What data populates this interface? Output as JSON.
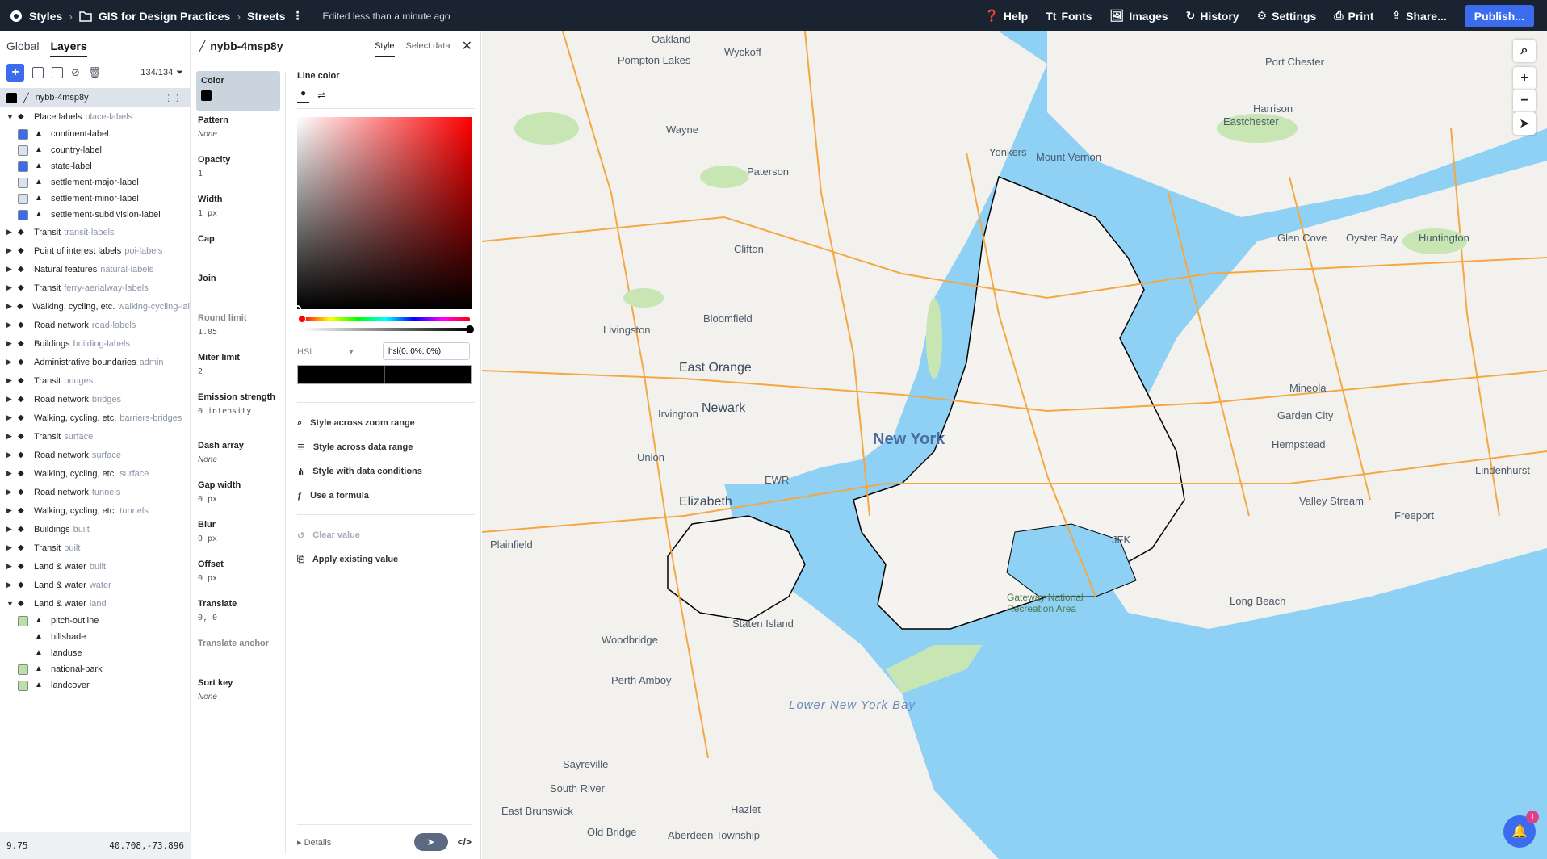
{
  "topbar": {
    "styles_label": "Styles",
    "project": "GIS for Design Practices",
    "style_name": "Streets",
    "edited": "Edited less than a minute ago",
    "help": "Help",
    "fonts": "Fonts",
    "images": "Images",
    "history": "History",
    "settings": "Settings",
    "print": "Print",
    "share": "Share...",
    "publish": "Publish..."
  },
  "left": {
    "tab_global": "Global",
    "tab_layers": "Layers",
    "count": "134/134",
    "selected_layer": "nybb-4msp8y",
    "layers": [
      {
        "name": "Place labels",
        "src": "place-labels",
        "open": true
      },
      {
        "name": "continent-label",
        "child": true,
        "swatch": "#3b6cf0"
      },
      {
        "name": "country-label",
        "child": true,
        "swatch": "#d9e2f0"
      },
      {
        "name": "state-label",
        "child": true,
        "swatch": "#3b6cf0"
      },
      {
        "name": "settlement-major-label",
        "child": true,
        "swatch": "#d9e2f0"
      },
      {
        "name": "settlement-minor-label",
        "child": true,
        "swatch": "#d9e2f0"
      },
      {
        "name": "settlement-subdivision-label",
        "child": true,
        "swatch": "#3b6cf0"
      },
      {
        "name": "Transit",
        "src": "transit-labels"
      },
      {
        "name": "Point of interest labels",
        "src": "poi-labels"
      },
      {
        "name": "Natural features",
        "src": "natural-labels"
      },
      {
        "name": "Transit",
        "src": "ferry-aerialway-labels"
      },
      {
        "name": "Walking, cycling, etc.",
        "src": "walking-cycling-lal"
      },
      {
        "name": "Road network",
        "src": "road-labels"
      },
      {
        "name": "Buildings",
        "src": "building-labels"
      },
      {
        "name": "Administrative boundaries",
        "src": "admin"
      },
      {
        "name": "Transit",
        "src": "bridges"
      },
      {
        "name": "Road network",
        "src": "bridges"
      },
      {
        "name": "Walking, cycling, etc.",
        "src": "barriers-bridges"
      },
      {
        "name": "Transit",
        "src": "surface"
      },
      {
        "name": "Road network",
        "src": "surface"
      },
      {
        "name": "Walking, cycling, etc.",
        "src": "surface"
      },
      {
        "name": "Road network",
        "src": "tunnels"
      },
      {
        "name": "Walking, cycling, etc.",
        "src": "tunnels"
      },
      {
        "name": "Buildings",
        "src": "built"
      },
      {
        "name": "Transit",
        "src": "built"
      },
      {
        "name": "Land & water",
        "src": "built"
      },
      {
        "name": "Land & water",
        "src": "water"
      },
      {
        "name": "Land & water",
        "src": "land",
        "open": true
      },
      {
        "name": "pitch-outline",
        "child": true,
        "swatch": "#b8e0a8"
      },
      {
        "name": "hillshade",
        "child": true,
        "swatch": "none"
      },
      {
        "name": "landuse",
        "child": true,
        "swatch": "none"
      },
      {
        "name": "national-park",
        "child": true,
        "swatch": "#b8e0a8"
      },
      {
        "name": "landcover",
        "child": true,
        "swatch": "#b8e0a8"
      }
    ],
    "zoom": "9.75",
    "coords": "40.708,-73.896"
  },
  "stylepanel": {
    "layer_name": "nybb-4msp8y",
    "tab_style": "Style",
    "tab_select_data": "Select data",
    "props": [
      {
        "label": "Color",
        "value": ""
      },
      {
        "label": "Pattern",
        "value": "None"
      },
      {
        "label": "Opacity",
        "value": "1"
      },
      {
        "label": "Width",
        "value": "1 px"
      },
      {
        "label": "Cap",
        "value": ""
      },
      {
        "label": "Join",
        "value": ""
      },
      {
        "label": "Round limit",
        "value": "1.05"
      },
      {
        "label": "Miter limit",
        "value": "2"
      },
      {
        "label": "Emission strength",
        "value": "0 intensity"
      },
      {
        "label": "Dash array",
        "value": "None"
      },
      {
        "label": "Gap width",
        "value": "0 px"
      },
      {
        "label": "Blur",
        "value": "0 px"
      },
      {
        "label": "Offset",
        "value": "0 px"
      },
      {
        "label": "Translate",
        "value": "0, 0"
      },
      {
        "label": "Translate anchor",
        "value": ""
      },
      {
        "label": "Sort key",
        "value": "None"
      }
    ],
    "editor_title": "Line color",
    "mode": "HSL",
    "color_value": "hsl(0, 0%, 0%)",
    "options": [
      "Style across zoom range",
      "Style across data range",
      "Style with data conditions",
      "Use a formula"
    ],
    "clear_value": "Clear value",
    "apply_existing": "Apply existing value",
    "details": "Details",
    "code": "</>"
  },
  "map": {
    "labels": [
      "Oakland",
      "Wyckoff",
      "Pompton Lakes",
      "Port Chester",
      "Harrison",
      "Wayne",
      "Eastchester",
      "Yonkers",
      "Mount Vernon",
      "Paterson",
      "Clifton",
      "Glen Cove",
      "Oyster Bay",
      "Huntington",
      "Livingston",
      "Bloomfield",
      "East Orange",
      "Newark",
      "Irvington",
      "New York",
      "Mineola",
      "Garden City",
      "Hempstead",
      "Union",
      "Elizabeth",
      "Valley Stream",
      "Freeport",
      "Lindenhurst",
      "Plainfield",
      "Staten Island",
      "Gateway National Recreation Area",
      "Long Beach",
      "Woodbridge",
      "Perth Amboy",
      "Sayreville",
      "South River",
      "East Brunswick",
      "Old Bridge",
      "Hazlet",
      "Aberdeen Township",
      "EWR",
      "JFK",
      "Lower New York Bay"
    ],
    "notifications": "1"
  }
}
